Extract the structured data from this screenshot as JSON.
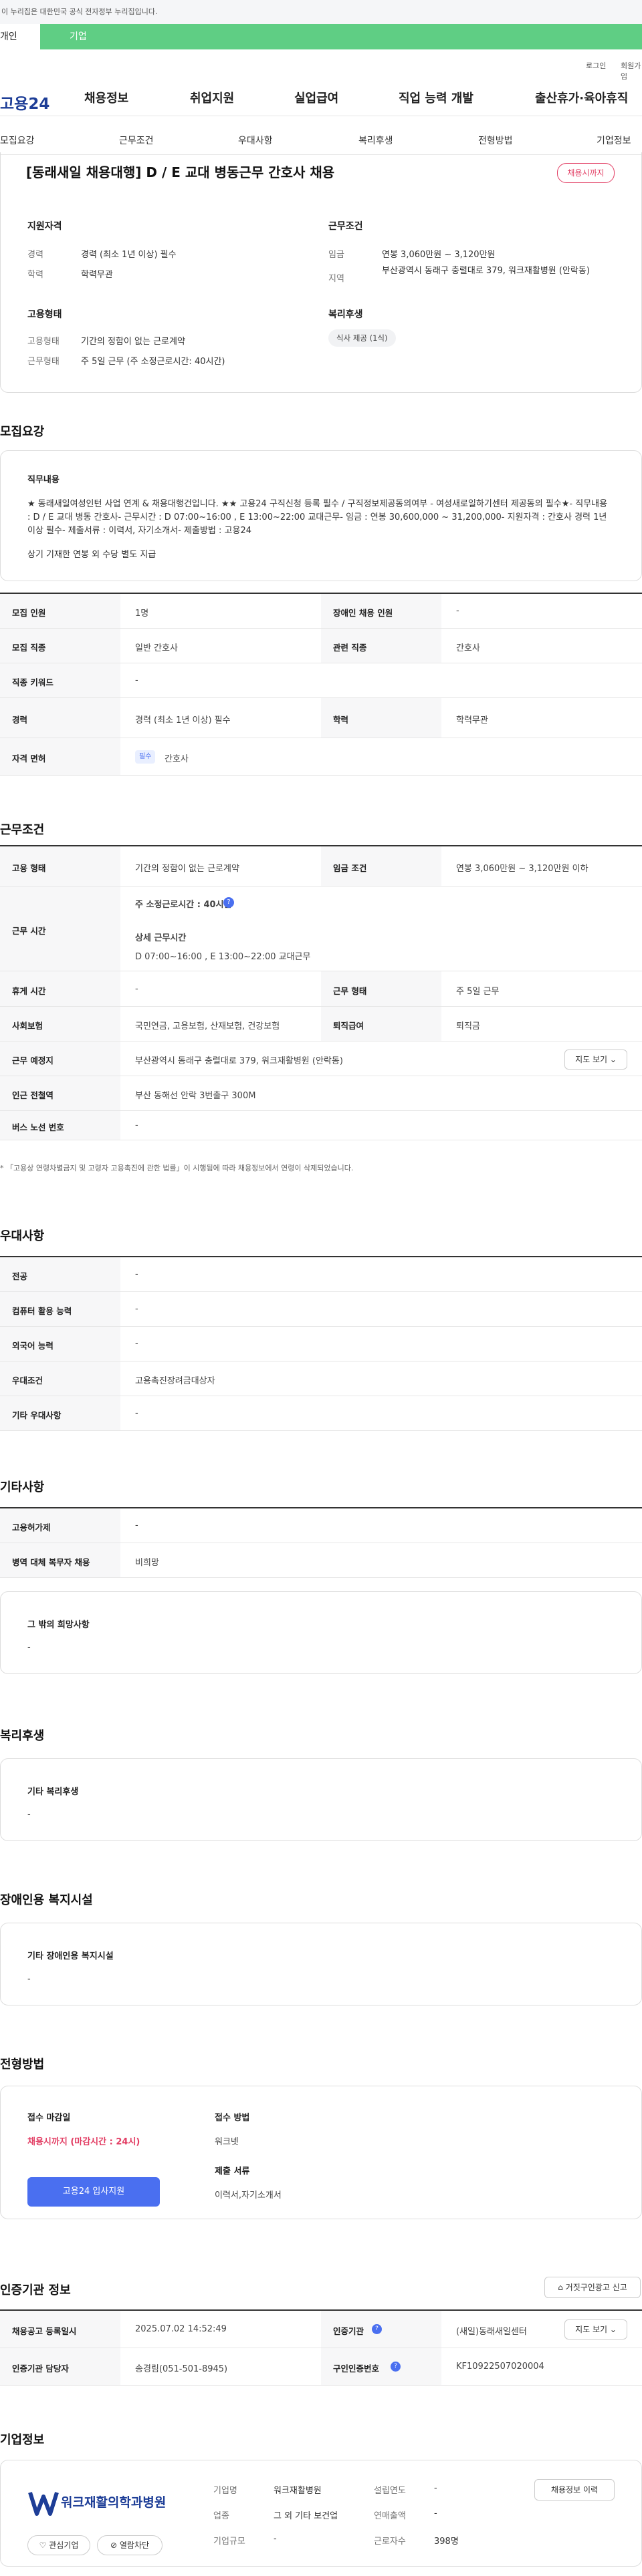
{
  "gov_notice": "이 누리집은 대한민국 공식 전자정부 누리집입니다.",
  "user_tabs": [
    "개인",
    "기업"
  ],
  "util": {
    "login": "로그인",
    "join": "회원가입"
  },
  "logo": "고용24",
  "gnb": [
    "채용정보",
    "취업지원",
    "실업급여",
    "직업 능력 개발",
    "출산휴가·육아휴직"
  ],
  "subnav": [
    "모집요강",
    "근무조건",
    "우대사항",
    "복리후생",
    "전형방법",
    "기업정보"
  ],
  "job": {
    "title": "[동래새일 채용대행] D / E 교대 병동근무 간호사 채용",
    "status": "채용시까지",
    "qual_h": "지원자격",
    "career_l": "경력",
    "career_v": "경력 (최소 1년 이상) 필수",
    "edu_l": "학력",
    "edu_v": "학력무관",
    "cond_h": "근무조건",
    "wage_l": "임금",
    "wage_v": "연봉 3,060만원 ~ 3,120만원",
    "region_l": "지역",
    "region_v": "부산광역시 동래구 충렬대로 379, 워크재활병원 (안락동)",
    "emp_h": "고용형태",
    "emp_l": "고용형태",
    "emp_v": "기간의 정함이 없는 근로계약",
    "hours_l": "근무형태",
    "hours_v": "주 5일 근무 (주 소정근로시간: 40시간)",
    "welfare_h": "복리후생",
    "welfare_tag": "식사 제공 (1식)"
  },
  "recruit": {
    "h": "모집요강",
    "duty_h": "직무내용",
    "duty_text": "★ 동래새일여성인턴 사업 연계 & 채용대행건입니다. ★★ 고용24 구직신청 등록 필수 / 구직정보제공동의여부 - 여성새로일하기센터 제공동의 필수★- 직무내용 : D / E 교대 병동 간호사- 근무시간 : D 07:00~16:00 , E 13:00~22:00 교대근무- 임금 : 연봉 30,600,000 ~ 31,200,000- 지원자격 : 간호사 경력 1년 이상 필수- 제출서류 : 이력서, 자기소개서- 제출방법 : 고용24",
    "duty_extra": "상기 기재한 연봉 외 수당 별도 지급",
    "rows": [
      {
        "k1": "모집 인원",
        "v1": "1명",
        "k2": "장애인 채용 인원",
        "v2": "-"
      },
      {
        "k1": "모집 직종",
        "v1": "일반 간호사",
        "k2": "관련 직종",
        "v2": "간호사"
      },
      {
        "k1": "직종 키워드",
        "v1": "-"
      },
      {
        "k1": "경력",
        "v1": "경력 (최소 1년 이상) 필수",
        "k2": "학력",
        "v2": "학력무관"
      }
    ],
    "license_k": "자격 면허",
    "license_badge": "필수",
    "license_v": "간호사"
  },
  "work": {
    "h": "근무조건",
    "type_k": "고용 형태",
    "type_v": "기간의 정함이 없는 근로계약",
    "wage_k": "임금 조건",
    "wage_v": "연봉 3,060만원 ~ 3,120만원 이하",
    "time_k": "근무 시간",
    "time_main": "주 소정근로시간 : 40시간",
    "time_sub_h": "상세 근무시간",
    "time_sub": "D 07:00~16:00 , E 13:00~22:00 교대근무",
    "rest_k": "휴게 시간",
    "rest_v": "-",
    "form_k": "근무 형태",
    "form_v": "주 5일 근무",
    "ins_k": "사회보험",
    "ins_v": "국민연금, 고용보험, 산재보험, 건강보험",
    "ret_k": "퇴직급여",
    "ret_v": "퇴직금",
    "place_k": "근무 예정지",
    "place_v": "부산광역시 동래구 충렬대로 379, 워크재활병원 (안락동)",
    "map_btn": "지도 보기",
    "subway_k": "인근 전철역",
    "subway_v": "부산 동해선 안락 3번출구 300M",
    "bus_k": "버스 노선 번호",
    "bus_v": "-",
    "note": "* 「고용상 연령차별금지 및 고령자 고용촉진에 관한 법률」이 시행됨에 따라 채용정보에서 연령이 삭제되었습니다."
  },
  "pref": {
    "h": "우대사항",
    "rows": [
      {
        "k": "전공",
        "v": "-"
      },
      {
        "k": "컴퓨터 활용 능력",
        "v": "-"
      },
      {
        "k": "외국어 능력",
        "v": "-"
      },
      {
        "k": "우대조건",
        "v": "고용촉진장려금대상자"
      },
      {
        "k": "기타 우대사항",
        "v": "-"
      }
    ]
  },
  "etc": {
    "h": "기타사항",
    "rows": [
      {
        "k": "고용허가제",
        "v": "-"
      },
      {
        "k": "병역 대체 복무자 채용",
        "v": "비희망"
      }
    ],
    "box_h": "그 밖의 희망사항",
    "box_v": "-"
  },
  "welfare": {
    "h": "복리후생",
    "box_h": "기타 복리후생",
    "box_v": "-"
  },
  "disab": {
    "h": "장애인용 복지시설",
    "box_h": "기타 장애인용 복지시설",
    "box_v": "-"
  },
  "select": {
    "h": "전형방법",
    "deadline_h": "접수 마감일",
    "deadline_v": "채용시까지 (마감시간 : 24시)",
    "apply_btn": "고용24 입사지원",
    "method_h": "접수 방법",
    "method_v": "워크넷",
    "docs_h": "제출 서류",
    "docs_v": "이력서,자기소개서"
  },
  "auth": {
    "h": "인증기관 정보",
    "report_btn": "거짓구인광고 신고",
    "reg_k": "채용공고 등록일시",
    "reg_v": "2025.07.02 14:52:49",
    "org_k": "인증기관",
    "org_v": "(새일)동래새일센터",
    "map_btn": "지도 보기",
    "mgr_k": "인증기관 담당자",
    "mgr_v": "송경림(051-501-8945)",
    "no_k": "구인인증번호",
    "no_v": "KF10922507020004"
  },
  "company": {
    "h": "기업정보",
    "logo_text": "워크재활의학과병원",
    "name_k": "기업명",
    "name_v": "워크재활병원",
    "year_k": "설립연도",
    "year_v": "-",
    "ind_k": "업종",
    "ind_v": "그 외 기타 보건업",
    "sales_k": "연매출액",
    "sales_v": "-",
    "size_k": "기업규모",
    "size_v": "-",
    "emp_k": "근로자수",
    "emp_v": "398명",
    "history_btn": "채용정보 이력",
    "fav_btn": "관심기업",
    "block_btn": "열람차단"
  },
  "colors": {
    "green": "#5fce84",
    "accent": "#e23d63",
    "blue": "#4a6ff0",
    "navy": "#1e3e97"
  }
}
